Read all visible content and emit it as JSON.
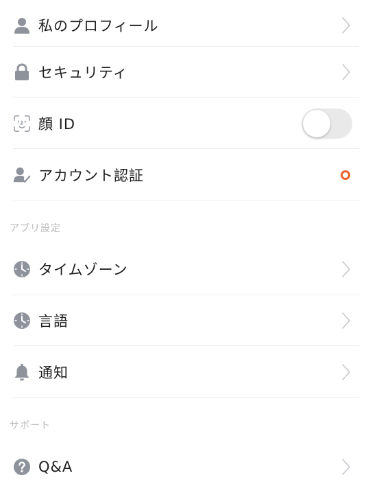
{
  "account": {
    "items": [
      {
        "id": "profile",
        "label": "私のプロフィール",
        "icon": "person-icon",
        "accessory": "chevron"
      },
      {
        "id": "security",
        "label": "セキュリティ",
        "icon": "lock-icon",
        "accessory": "chevron"
      },
      {
        "id": "face-id",
        "label": "顔 ID",
        "icon": "face-id-icon",
        "accessory": "toggle",
        "toggle_on": false
      },
      {
        "id": "verification",
        "label": "アカウント認証",
        "icon": "person-check-icon",
        "accessory": "status-dot"
      }
    ]
  },
  "app_settings": {
    "header": "アプリ設定",
    "items": [
      {
        "id": "timezone",
        "label": "タイムゾーン",
        "icon": "clock-icon",
        "accessory": "chevron"
      },
      {
        "id": "language",
        "label": "言語",
        "icon": "clock-icon",
        "accessory": "chevron"
      },
      {
        "id": "notifications",
        "label": "通知",
        "icon": "bell-icon",
        "accessory": "chevron"
      }
    ]
  },
  "support": {
    "header": "サポート",
    "items": [
      {
        "id": "qa",
        "label": "Q&A",
        "icon": "question-icon",
        "accessory": "chevron"
      }
    ]
  },
  "colors": {
    "icon_gray": "#8e929b",
    "chevron_gray": "#c7c7cc",
    "divider": "#ececec",
    "section_header": "#b8b8b8",
    "status_dot": "#e8632c",
    "toggle_off": "#e9e9ea"
  }
}
